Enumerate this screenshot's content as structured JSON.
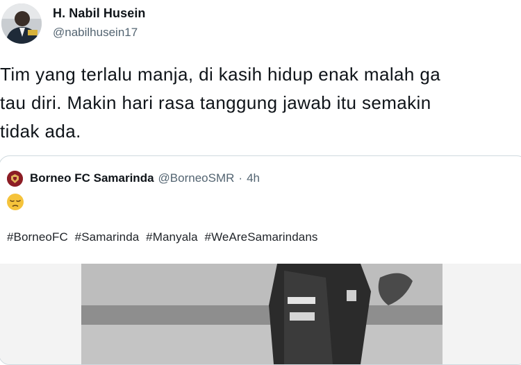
{
  "author": {
    "name": "H. Nabil Husein",
    "handle": "@nabilhusein17"
  },
  "tweet": {
    "text": "Tim yang terlalu manja, di kasih hidup enak malah ga\ntau diri. Makin hari rasa tanggung jawab itu semakin\ntidak ada."
  },
  "quoted": {
    "name": "Borneo FC Samarinda",
    "handle": "@BorneoSMR",
    "separator": "·",
    "time": "4h",
    "emoji": "pensive-face",
    "hashtags": [
      "#BorneoFC",
      "#Samarinda",
      "#Manyala",
      "#WeAreSamarindans"
    ],
    "media": "black-and-white photo of a football player"
  },
  "colors": {
    "text": "#0f1419",
    "secondary": "#536471",
    "border": "#cfd9de",
    "club": "#8c1d25"
  }
}
